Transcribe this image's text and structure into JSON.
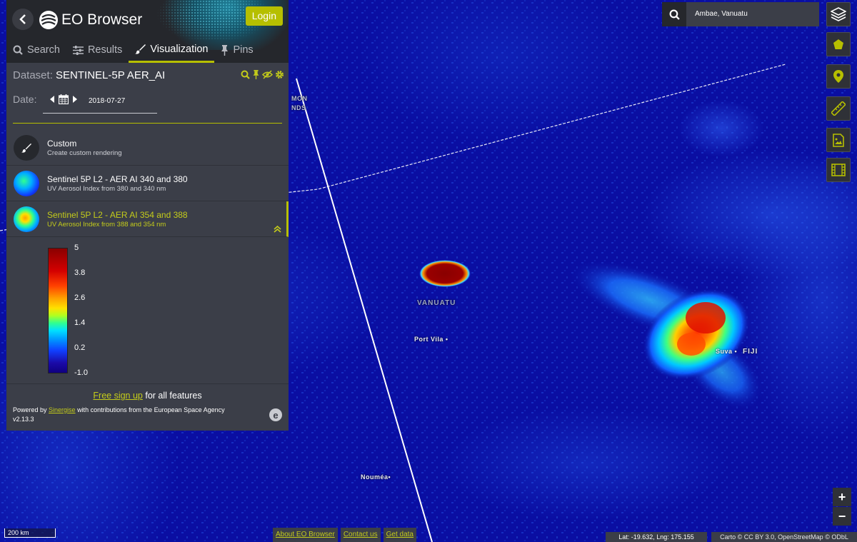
{
  "app": {
    "title": "EO Browser",
    "login_label": "Login"
  },
  "tabs": [
    {
      "label": "Search",
      "icon": "search-icon"
    },
    {
      "label": "Results",
      "icon": "sliders-icon"
    },
    {
      "label": "Visualization",
      "icon": "paintbrush-icon",
      "active": true
    },
    {
      "label": "Pins",
      "icon": "pin-icon"
    }
  ],
  "dataset": {
    "label": "Dataset:",
    "name": "SENTINEL-5P AER_AI"
  },
  "date": {
    "label": "Date:",
    "value": "2018-07-27"
  },
  "layers": [
    {
      "title": "Custom",
      "description": "Create custom rendering"
    },
    {
      "title": "Sentinel 5P L2 - AER AI 340 and 380",
      "description": "UV Aerosol Index from 380 and 340 nm"
    },
    {
      "title": "Sentinel 5P L2 - AER AI 354 and 388",
      "description": "UV Aerosol Index from 388 and 354 nm",
      "active": true
    }
  ],
  "legend": {
    "ticks": [
      "5",
      "3.8",
      "2.6",
      "1.4",
      "0.2",
      "-1.0"
    ]
  },
  "footer": {
    "signup_link": "Free sign up",
    "signup_rest": " for all features",
    "powered_prefix": "Powered by ",
    "powered_link": "Sinergise",
    "powered_rest": " with contributions from the European Space Agency",
    "version": "v2.13.3",
    "esa_glyph": "e"
  },
  "search": {
    "value": "Ambae, Vanuatu"
  },
  "tools": [
    {
      "name": "layers-icon"
    },
    {
      "name": "polygon-icon"
    },
    {
      "name": "location-pin-icon"
    },
    {
      "name": "ruler-icon"
    },
    {
      "name": "image-download-icon"
    },
    {
      "name": "film-icon"
    }
  ],
  "zoom": {
    "in": "+",
    "out": "−"
  },
  "map_labels": {
    "solomon_1": "MON",
    "solomon_2": "NDS",
    "vanuatu": "VANUATU",
    "port_vila": "Port Vila",
    "suva": "Suva",
    "fiji": "FIJI",
    "noumea": "Nouméa"
  },
  "scale": "200 km",
  "bottom_links": [
    "About EO Browser",
    "Contact us",
    "Get data"
  ],
  "coords": "Lat: -19.632, Lng: 175.155",
  "attribution": "Carto © CC BY 3.0, OpenStreetMap © ODbL",
  "colors": {
    "accent": "#b6bf00",
    "panel": "#3b3e48",
    "header": "#25272c",
    "ocean": "#0a0ea2"
  }
}
